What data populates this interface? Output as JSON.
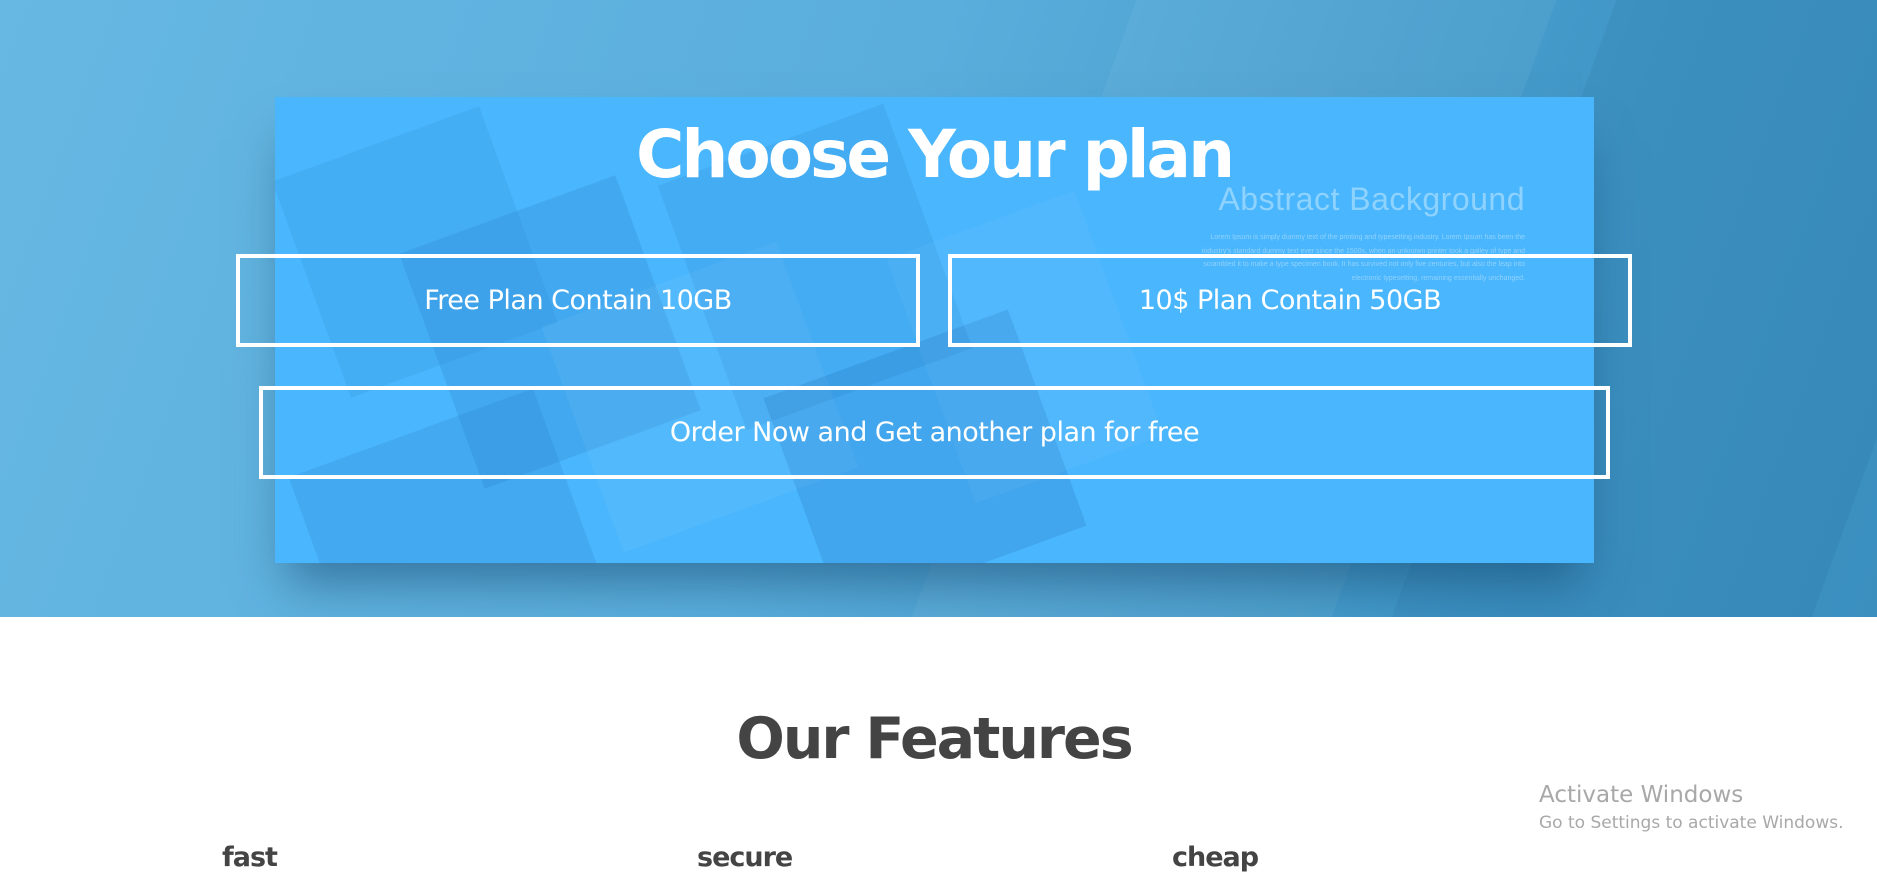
{
  "hero": {
    "title": "Choose Your plan",
    "stock_image": {
      "title": "Abstract  Background",
      "body": "Lorem Ipsum is simply dummy text of the printing and typesetting industry. Lorem Ipsum has been the industry's standard dummy text ever since the 1500s, when an unknown printer took a galley of type and scrambled it to make a type specimen book. It has survived not only five centuries, but also the leap into electronic typesetting, remaining essentially unchanged."
    },
    "plans": {
      "free_label": "Free Plan Contain 10GB",
      "paid_label": "10$ Plan Contain 50GB",
      "order_label": "Order Now and Get another plan for free"
    }
  },
  "features": {
    "title": "Our Features",
    "items": [
      "fast",
      "secure",
      "cheap"
    ]
  },
  "windows_watermark": {
    "title": "Activate Windows",
    "subtitle": "Go to Settings to activate Windows."
  },
  "colors": {
    "hero_background": "#5aaedc",
    "panel_background": "#4ab6fd",
    "button_border": "#ffffff",
    "heading_dark": "#444444"
  }
}
